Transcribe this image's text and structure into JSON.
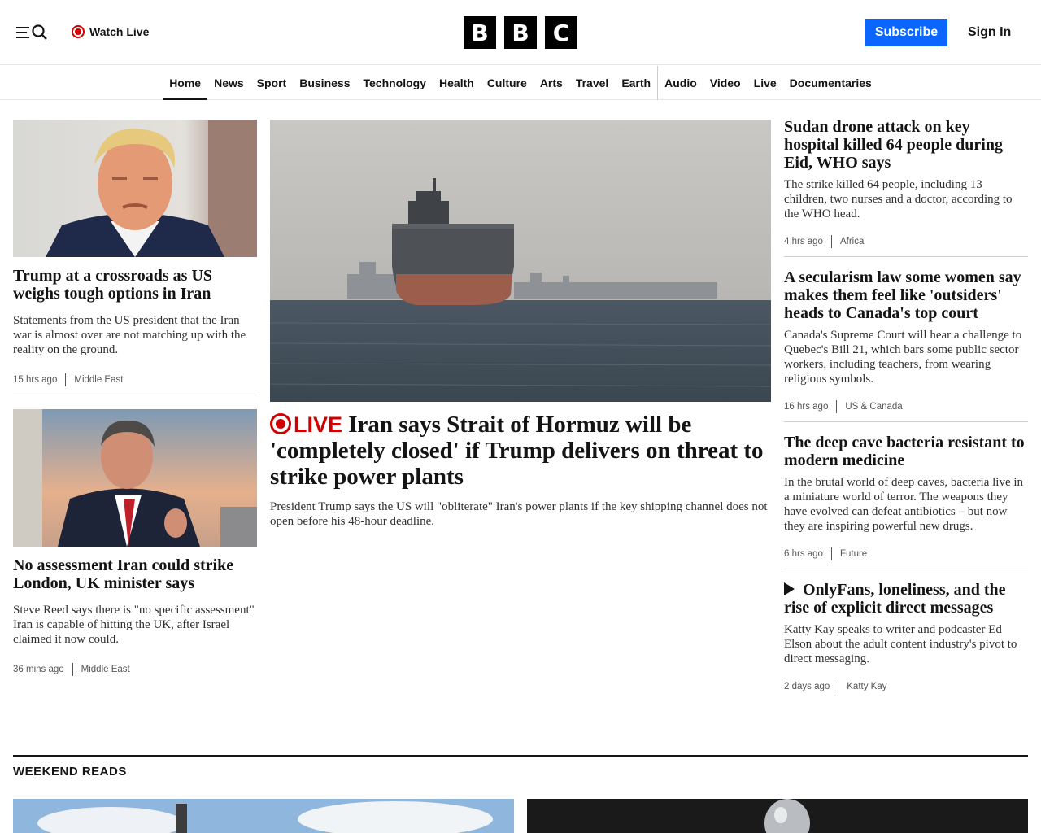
{
  "header": {
    "watch_live": "Watch Live",
    "logo_letters": [
      "B",
      "B",
      "C"
    ],
    "subscribe": "Subscribe",
    "sign_in": "Sign In"
  },
  "nav": {
    "items": [
      "Home",
      "News",
      "Sport",
      "Business",
      "Technology",
      "Health",
      "Culture",
      "Arts",
      "Travel",
      "Earth",
      "Audio",
      "Video",
      "Live",
      "Documentaries"
    ],
    "active": "Home"
  },
  "left": [
    {
      "headline": "Trump at a crossroads as US weighs tough options in Iran",
      "summary": "Statements from the US president that the Iran war is almost over are not matching up with the reality on the ground.",
      "time": "15 hrs ago",
      "tag": "Middle East"
    },
    {
      "headline": "No assessment Iran could strike London, UK minister says",
      "summary": "Steve Reed says there is \"no specific assessment\" Iran is capable of hitting the UK, after Israel claimed it now could.",
      "time": "36 mins ago",
      "tag": "Middle East"
    }
  ],
  "lead": {
    "live_label": "LIVE",
    "headline": "Iran says Strait of Hormuz will be 'completely closed' if Trump delivers on threat to strike power plants",
    "summary": "President Trump says the US will \"obliterate\" Iran's power plants if the key shipping channel does not open before his 48-hour deadline."
  },
  "right": [
    {
      "headline": "Sudan drone attack on key hospital killed 64 people during Eid, WHO says",
      "summary": "The strike killed 64 people, including 13 children, two nurses and a doctor, according to the WHO head.",
      "time": "4 hrs ago",
      "tag": "Africa"
    },
    {
      "headline": "A secularism law some women say makes them feel like 'outsiders' heads to Canada's top court",
      "summary": "Canada's Supreme Court will hear a challenge to Quebec's Bill 21, which bars some public sector workers, including teachers, from wearing religious symbols.",
      "time": "16 hrs ago",
      "tag": "US & Canada"
    },
    {
      "headline": "The deep cave bacteria resistant to modern medicine",
      "summary": "In the brutal world of deep caves, bacteria live in a miniature world of terror. The weapons they have evolved can defeat antibiotics – but now they are inspiring powerful new drugs.",
      "time": "6 hrs ago",
      "tag": "Future"
    },
    {
      "headline": "OnlyFans, loneliness, and the rise of explicit direct messages",
      "summary": "Katty Kay speaks to writer and podcaster Ed Elson about the adult content industry's pivot to direct messaging.",
      "time": "2 days ago",
      "tag": "Katty Kay"
    }
  ],
  "weekend": {
    "title": "WEEKEND READS"
  },
  "colors": {
    "accent": "#0a66ff",
    "live": "#d10000",
    "text": "#141414"
  }
}
